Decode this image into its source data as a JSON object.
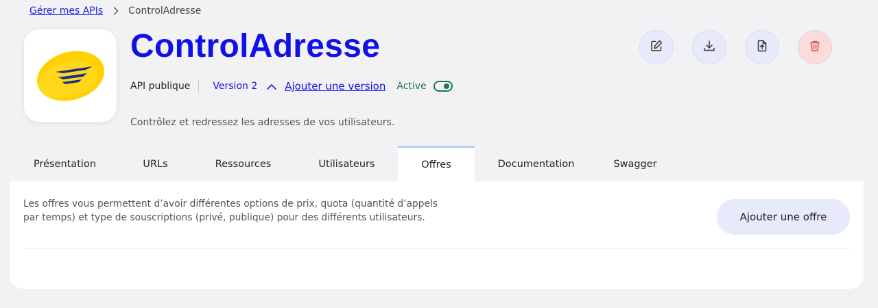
{
  "breadcrumb": {
    "parent": "Gérer mes APIs",
    "current": "ControlAdresse"
  },
  "api": {
    "title": "ControlAdresse",
    "visibility": "API publique",
    "version": "Version 2",
    "add_version": "Ajouter une version",
    "status": "Active",
    "description": "Contrôlez et redressez les adresses de vos utilisateurs."
  },
  "actions": [
    {
      "name": "edit",
      "icon": "pencil-square-icon"
    },
    {
      "name": "download",
      "icon": "download-icon"
    },
    {
      "name": "export",
      "icon": "file-upload-icon"
    },
    {
      "name": "delete",
      "icon": "trash-icon"
    }
  ],
  "tabs": [
    "Présentation",
    "URLs",
    "Ressources",
    "Utilisateurs",
    "Offres",
    "Documentation",
    "Swagger"
  ],
  "active_tab": "Offres",
  "offers": {
    "intro": "Les offres vous permettent d’avoir différentes options de prix, quota (quantité d’appels par temps) et type de souscriptions (privé, publique) pour des différents utilisateurs.",
    "add_button": "Ajouter une offre"
  },
  "colors": {
    "primary": "#1010e8",
    "active": "#1a7a4c",
    "danger": "#e0474f",
    "logo_yellow": "#ffd200"
  }
}
